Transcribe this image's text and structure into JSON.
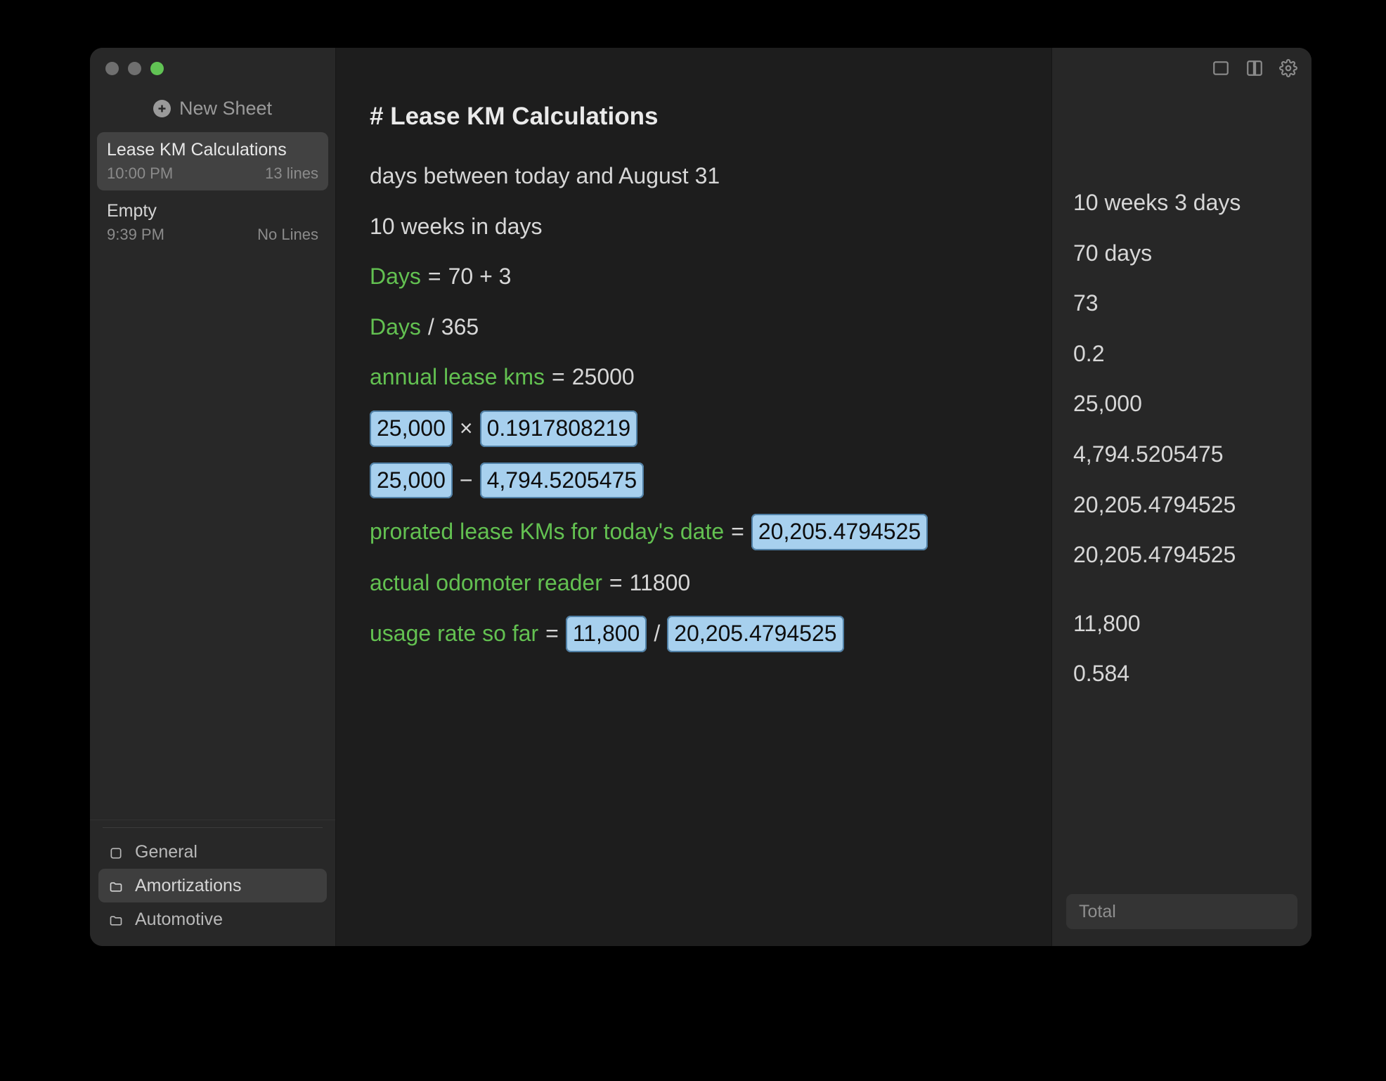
{
  "sidebar": {
    "new_sheet_label": "New Sheet",
    "sheets": [
      {
        "title": "Lease KM Calculations",
        "time": "10:00 PM",
        "lines": "13 lines",
        "selected": true
      },
      {
        "title": "Empty",
        "time": "9:39 PM",
        "lines": "No Lines",
        "selected": false
      }
    ],
    "folders": [
      {
        "label": "General",
        "icon": "square",
        "selected": false
      },
      {
        "label": "Amortizations",
        "icon": "folder",
        "selected": true
      },
      {
        "label": "Automotive",
        "icon": "folder",
        "selected": false
      }
    ]
  },
  "document": {
    "title": "# Lease KM Calculations",
    "lines": [
      {
        "tokens": [
          {
            "t": "text",
            "v": "days between today and August 31"
          }
        ]
      },
      {
        "tokens": [
          {
            "t": "text",
            "v": "10 weeks in days"
          }
        ]
      },
      {
        "tokens": [
          {
            "t": "var",
            "v": "Days"
          },
          {
            "t": "op",
            "v": " ="
          },
          {
            "t": "num",
            "v": "70 + 3"
          }
        ]
      },
      {
        "tokens": [
          {
            "t": "var",
            "v": "Days"
          },
          {
            "t": "op",
            "v": "/"
          },
          {
            "t": "num",
            "v": "365"
          }
        ]
      },
      {
        "tokens": [
          {
            "t": "var",
            "v": "annual lease kms"
          },
          {
            "t": "op",
            "v": " = "
          },
          {
            "t": "num",
            "v": "25000"
          }
        ]
      },
      {
        "tokens": [
          {
            "t": "chip",
            "v": "25,000"
          },
          {
            "t": "op",
            "v": " × "
          },
          {
            "t": "chip",
            "v": "0.1917808219"
          }
        ]
      },
      {
        "tokens": [
          {
            "t": "chip",
            "v": "25,000"
          },
          {
            "t": "op",
            "v": " − "
          },
          {
            "t": "chip",
            "v": "4,794.5205475"
          }
        ]
      },
      {
        "tokens": [
          {
            "t": "var",
            "v": "prorated lease KMs for today's date"
          },
          {
            "t": "op",
            "v": " = "
          },
          {
            "t": "chip",
            "v": "20,205.4794525"
          }
        ]
      },
      {
        "tokens": [
          {
            "t": "var",
            "v": "actual odomoter reader"
          },
          {
            "t": "op",
            "v": " = "
          },
          {
            "t": "num",
            "v": "11800"
          }
        ]
      },
      {
        "tokens": [
          {
            "t": "var",
            "v": "usage rate so far"
          },
          {
            "t": "op",
            "v": " = "
          },
          {
            "t": "chip",
            "v": "11,800"
          },
          {
            "t": "op",
            "v": "/"
          },
          {
            "t": "chip",
            "v": "20,205.4794525"
          }
        ]
      }
    ],
    "results": [
      {
        "v": "10 weeks 3 days"
      },
      {
        "v": "70 days"
      },
      {
        "v": "73"
      },
      {
        "v": "0.2"
      },
      {
        "v": "25,000"
      },
      {
        "v": "4,794.5205475"
      },
      {
        "v": "20,205.4794525"
      },
      {
        "v": "20,205.4794525"
      },
      {
        "v": "11,800"
      },
      {
        "v": "0.584"
      }
    ],
    "big_gap_after_index": 7
  },
  "footer": {
    "total_label": "Total"
  }
}
